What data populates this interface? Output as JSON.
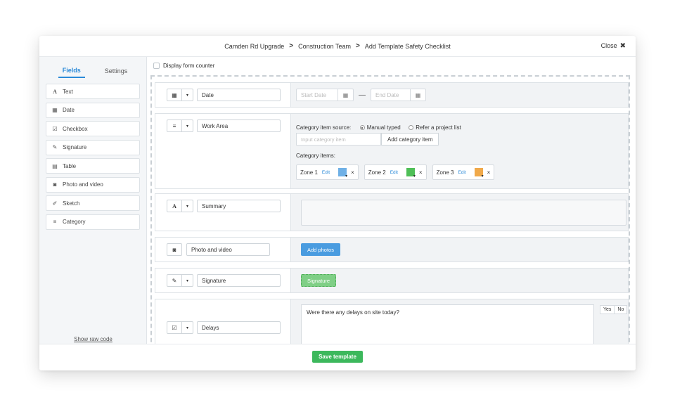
{
  "header": {
    "breadcrumbs": [
      "Camden Rd Upgrade",
      "Construction Team",
      "Add Template Safety Checklist"
    ],
    "separator": ">",
    "close_label": "Close",
    "close_icon": "✖"
  },
  "sidebar": {
    "tabs": [
      {
        "label": "Fields",
        "active": true
      },
      {
        "label": "Settings",
        "active": false
      }
    ],
    "items": [
      {
        "label": "Text",
        "icon": "text-icon",
        "glyph": "A"
      },
      {
        "label": "Date",
        "icon": "calendar-icon",
        "glyph": "▦"
      },
      {
        "label": "Checkbox",
        "icon": "checkbox-icon",
        "glyph": "☑"
      },
      {
        "label": "Signature",
        "icon": "pen-icon",
        "glyph": "✎"
      },
      {
        "label": "Table",
        "icon": "table-icon",
        "glyph": "▤"
      },
      {
        "label": "Photo and video",
        "icon": "camera-icon",
        "glyph": "◙"
      },
      {
        "label": "Sketch",
        "icon": "pencil-icon",
        "glyph": "✐"
      },
      {
        "label": "Category",
        "icon": "list-icon",
        "glyph": "≡"
      }
    ],
    "raw_code_link": "Show raw code"
  },
  "main": {
    "counter_label": "Display form counter",
    "rows": {
      "date": {
        "name": "Date",
        "icon_glyph": "▦",
        "caret": "▾",
        "start_placeholder": "Start Date",
        "end_placeholder": "End Date",
        "dash": "—",
        "cal_glyph": "▦"
      },
      "work_area": {
        "name": "Work Area",
        "icon_glyph": "≡",
        "caret": "▾",
        "source_label": "Category item source:",
        "option_manual": "Manual typed",
        "option_project": "Refer a project list",
        "selected_source": "Manual typed",
        "input_placeholder": "Input category item",
        "add_button": "Add category item",
        "items_label": "Category items:",
        "edit_label": "Edit",
        "remove_glyph": "×",
        "zones": [
          {
            "label": "Zone 1",
            "color": "#6fb0e6"
          },
          {
            "label": "Zone 2",
            "color": "#4fbf57"
          },
          {
            "label": "Zone 3",
            "color": "#f0a94a"
          }
        ]
      },
      "summary": {
        "name": "Summary",
        "icon_glyph": "A",
        "caret": "▾"
      },
      "photo": {
        "name": "Photo and video",
        "icon_glyph": "◙",
        "button": "Add photos"
      },
      "signature": {
        "name": "Signature",
        "icon_glyph": "✎",
        "caret": "▾",
        "button": "Signature"
      },
      "delays": {
        "name": "Delays",
        "icon_glyph": "☑",
        "caret": "▾",
        "question": "Were there any delays on site today?",
        "yes": "Yes",
        "no": "No"
      }
    }
  },
  "footer": {
    "save_label": "Save template"
  },
  "colors": {
    "accent": "#2b8ad8",
    "save": "#3cb85c",
    "photo_button": "#4a9ce0"
  }
}
